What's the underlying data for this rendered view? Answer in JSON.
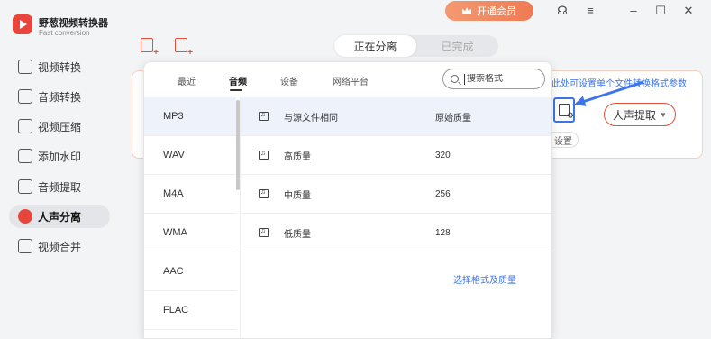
{
  "app": {
    "title": "野葱视频转换器",
    "subtitle": "Fast conversion"
  },
  "sidebar": {
    "items": [
      {
        "label": "视频转换",
        "icon": "video-convert-icon"
      },
      {
        "label": "音频转换",
        "icon": "audio-convert-icon"
      },
      {
        "label": "视频压缩",
        "icon": "video-compress-icon"
      },
      {
        "label": "添加水印",
        "icon": "watermark-icon"
      },
      {
        "label": "音频提取",
        "icon": "audio-extract-icon"
      },
      {
        "label": "人声分离",
        "icon": "voice-separate-icon",
        "active": true
      },
      {
        "label": "视频合并",
        "icon": "video-merge-icon"
      }
    ]
  },
  "topbar": {
    "vip_label": "开通会员",
    "controls": [
      "headset-icon",
      "menu-icon",
      "minimize-icon",
      "maximize-icon",
      "close-icon"
    ]
  },
  "toolbar": {
    "segments": [
      {
        "label": "正在分离",
        "active": true
      },
      {
        "label": "已完成",
        "active": false
      }
    ]
  },
  "task": {
    "hint": "此处可设置单个文件转换格式参数",
    "extract_label": "人声提取",
    "settings_label": "设置"
  },
  "popup": {
    "tabs": [
      {
        "label": "最近",
        "active": false
      },
      {
        "label": "音频",
        "active": true
      },
      {
        "label": "设备",
        "active": false
      },
      {
        "label": "网络平台",
        "active": false
      }
    ],
    "search_placeholder": "搜索格式",
    "formats": [
      "MP3",
      "WAV",
      "M4A",
      "WMA",
      "AAC",
      "FLAC"
    ],
    "selected_format": "MP3",
    "qualities": [
      {
        "name": "与源文件相同",
        "value": "原始质量"
      },
      {
        "name": "高质量",
        "value": "320"
      },
      {
        "name": "中质量",
        "value": "256"
      },
      {
        "name": "低质量",
        "value": "128"
      }
    ],
    "footer_link": "选择格式及质量"
  },
  "colors": {
    "accent": "#e8503c",
    "link": "#3d74e6",
    "selected_row": "#eef2fb"
  }
}
